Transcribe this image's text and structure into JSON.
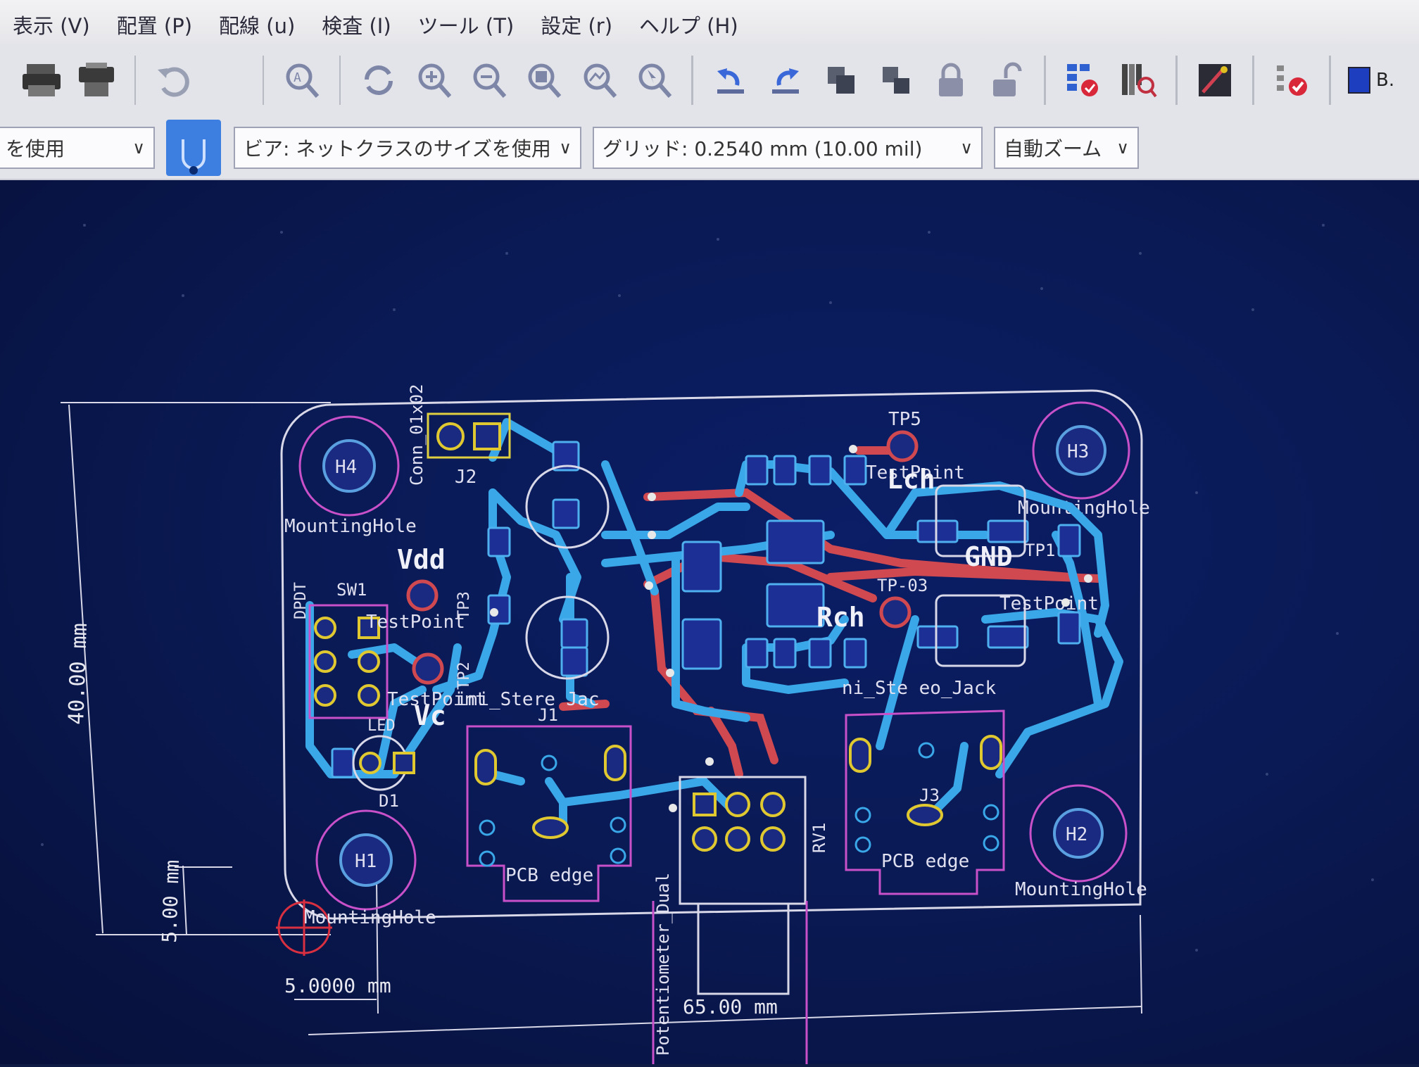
{
  "menu": [
    "表示 (V)",
    "配置 (P)",
    "配線 (u)",
    "検査 (I)",
    "ツール (T)",
    "設定 (r)",
    "ヘルプ (H)"
  ],
  "toolbar_icons": [
    "print-icon",
    "plot-icon",
    "undo-icon",
    "zoom-redraw-icon",
    "refresh-icon",
    "zoom-in-icon",
    "zoom-out-icon",
    "zoom-fit-icon",
    "zoom-objects-icon",
    "zoom-selection-icon",
    "rotate-ccw-icon",
    "rotate-cw-icon",
    "group-icon",
    "ungroup-icon",
    "lock-icon",
    "unlock-icon",
    "netlist-icon",
    "board-setup-icon",
    "scripting-icon",
    "drc-icon"
  ],
  "toolbar_right_label": "B.",
  "track_select": "を使用",
  "via_select": "ビア: ネットクラスのサイズを使用",
  "grid_select": "グリッド: 0.2540 mm (10.00 mil)",
  "zoom_select": "自動ズーム",
  "board": {
    "refs": {
      "h1": "H1",
      "h2": "H2",
      "h3": "H3",
      "h4": "H4",
      "j1": "J1",
      "j2": "J2",
      "j3": "J3",
      "d1": "D1",
      "sw1": "SW1",
      "rv1": "RV1",
      "tp5": "TP5",
      "tp1": "TP1",
      "tp3": "TP3",
      "tp2": "TP2"
    },
    "labels": {
      "mounting_hole_tl": "MountingHole",
      "mounting_hole_bl": "MountingHole",
      "mounting_hole_r": "MountingHole",
      "mounting_hole_br": "MountingHole",
      "conn": "Conn_01x02",
      "vdd": "Vdd",
      "vcc": "Vc",
      "lch": "Lch",
      "rch": "Rch",
      "gnd": "GND",
      "testpoint1": "TestPoint",
      "testpoint2": "TestPoint",
      "testpoint3": "TestPoint",
      "testpoint4": "TestPoint",
      "jack1": "ini_Stere  Jac",
      "jack2": "ni_Ste  eo_Jack",
      "led": "LED",
      "pcb_edge1": "PCB edge",
      "pcb_edge2": "PCB edge",
      "potentiometer": "Potentiometer_Dual",
      "dpdt": "DPDT",
      "tp_label": "TP-03"
    },
    "dims": {
      "height": "40.00 mm",
      "hole_offset_v": "5.00 mm",
      "hole_offset_h": "5.0000 mm",
      "width": "65.00 mm"
    }
  }
}
